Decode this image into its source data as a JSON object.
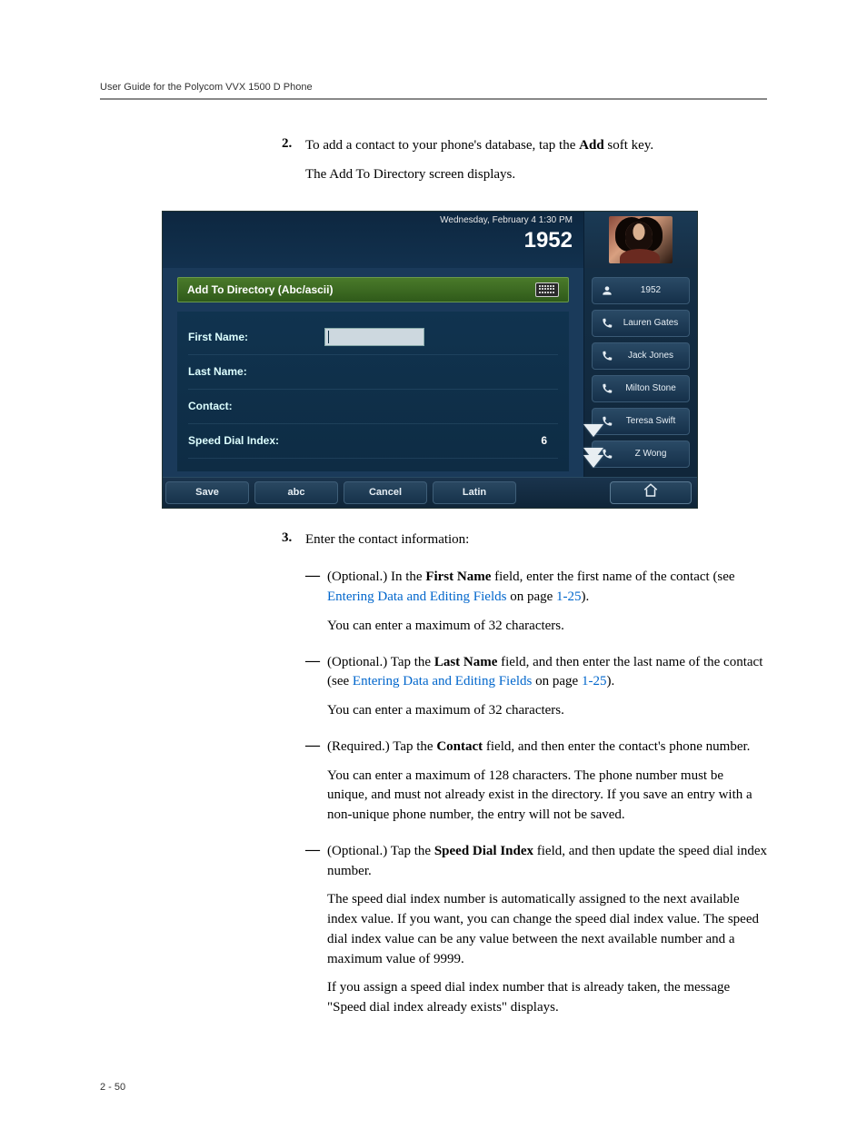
{
  "header": {
    "title": "User Guide for the Polycom VVX 1500 D Phone"
  },
  "footer": {
    "page": "2 - 50"
  },
  "steps": {
    "s2": {
      "num": "2.",
      "line1_a": "To add a contact to your phone's database, tap the ",
      "line1_bold": "Add",
      "line1_b": " soft key.",
      "line2": "The Add To Directory screen displays."
    },
    "s3": {
      "num": "3.",
      "line1": "Enter the contact information:"
    }
  },
  "bullets": {
    "b1": {
      "pre": "(Optional.) In the ",
      "bold": "First Name",
      "mid": " field, enter the first name of the contact (see ",
      "link": "Entering Data and Editing Fields",
      "post_a": " on page ",
      "link2": "1-25",
      "post_b": ").",
      "p2": "You can enter a maximum of 32 characters."
    },
    "b2": {
      "pre": "(Optional.) Tap the ",
      "bold": "Last Name",
      "mid": " field, and then enter the last name of the contact (see ",
      "link": "Entering Data and Editing Fields",
      "post_a": " on page ",
      "link2": "1-25",
      "post_b": ").",
      "p2": "You can enter a maximum of 32 characters."
    },
    "b3": {
      "pre": "(Required.) Tap the ",
      "bold": "Contact",
      "mid": " field, and then enter the contact's phone number.",
      "p2": "You can enter a maximum of 128 characters. The phone number must be unique, and must not already exist in the directory. If you save an entry with a non-unique phone number, the entry will not be saved."
    },
    "b4": {
      "pre": "(Optional.) Tap the ",
      "bold": "Speed Dial Index",
      "mid": " field, and then update the speed dial index number.",
      "p2": "The speed dial index number is automatically assigned to the next available index value. If you want, you can change the speed dial index value. The speed dial index value can be any value between the next available number and a maximum value of 9999.",
      "p3": "If you assign a speed dial index number that is already taken, the message \"Speed dial index already exists\" displays."
    }
  },
  "shot": {
    "date": "Wednesday, February 4  1:30 PM",
    "ext": "1952",
    "title": "Add To Directory (Abc/ascii)",
    "fields": {
      "first_name": "First Name:",
      "last_name": "Last Name:",
      "contact": "Contact:",
      "speed_dial": "Speed Dial Index:",
      "speed_dial_value": "6"
    },
    "side": [
      "1952",
      "Lauren Gates",
      "Jack Jones",
      "Milton Stone",
      "Teresa Swift",
      "Z Wong"
    ],
    "softkeys": {
      "save": "Save",
      "abc": "abc",
      "cancel": "Cancel",
      "latin": "Latin"
    }
  }
}
